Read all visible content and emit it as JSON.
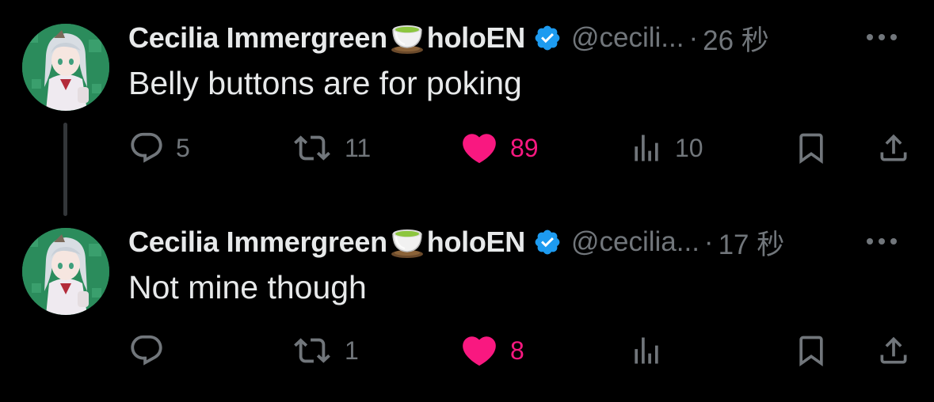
{
  "colors": {
    "background": "#000000",
    "text_primary": "#e7e9ea",
    "text_secondary": "#71767b",
    "like_active": "#f91880",
    "verified": "#1d9bf0"
  },
  "tweets": [
    {
      "author": {
        "display_name": "Cecilia Immergreen",
        "name_emoji": "tea-cup-icon",
        "name_suffix": "holoEN",
        "verified": true,
        "handle": "@cecili...",
        "separator": "·",
        "time": "26 秒"
      },
      "text": "Belly buttons are for poking",
      "actions": {
        "reply_count": "5",
        "retweet_count": "11",
        "like_count": "89",
        "liked": true,
        "views_count": "10"
      }
    },
    {
      "author": {
        "display_name": "Cecilia Immergreen",
        "name_emoji": "tea-cup-icon",
        "name_suffix": "holoEN",
        "verified": true,
        "handle": "@cecilia...",
        "separator": "·",
        "time": "17 秒"
      },
      "text": "Not mine though",
      "actions": {
        "reply_count": "",
        "retweet_count": "1",
        "like_count": "8",
        "liked": true,
        "views_count": ""
      }
    }
  ]
}
